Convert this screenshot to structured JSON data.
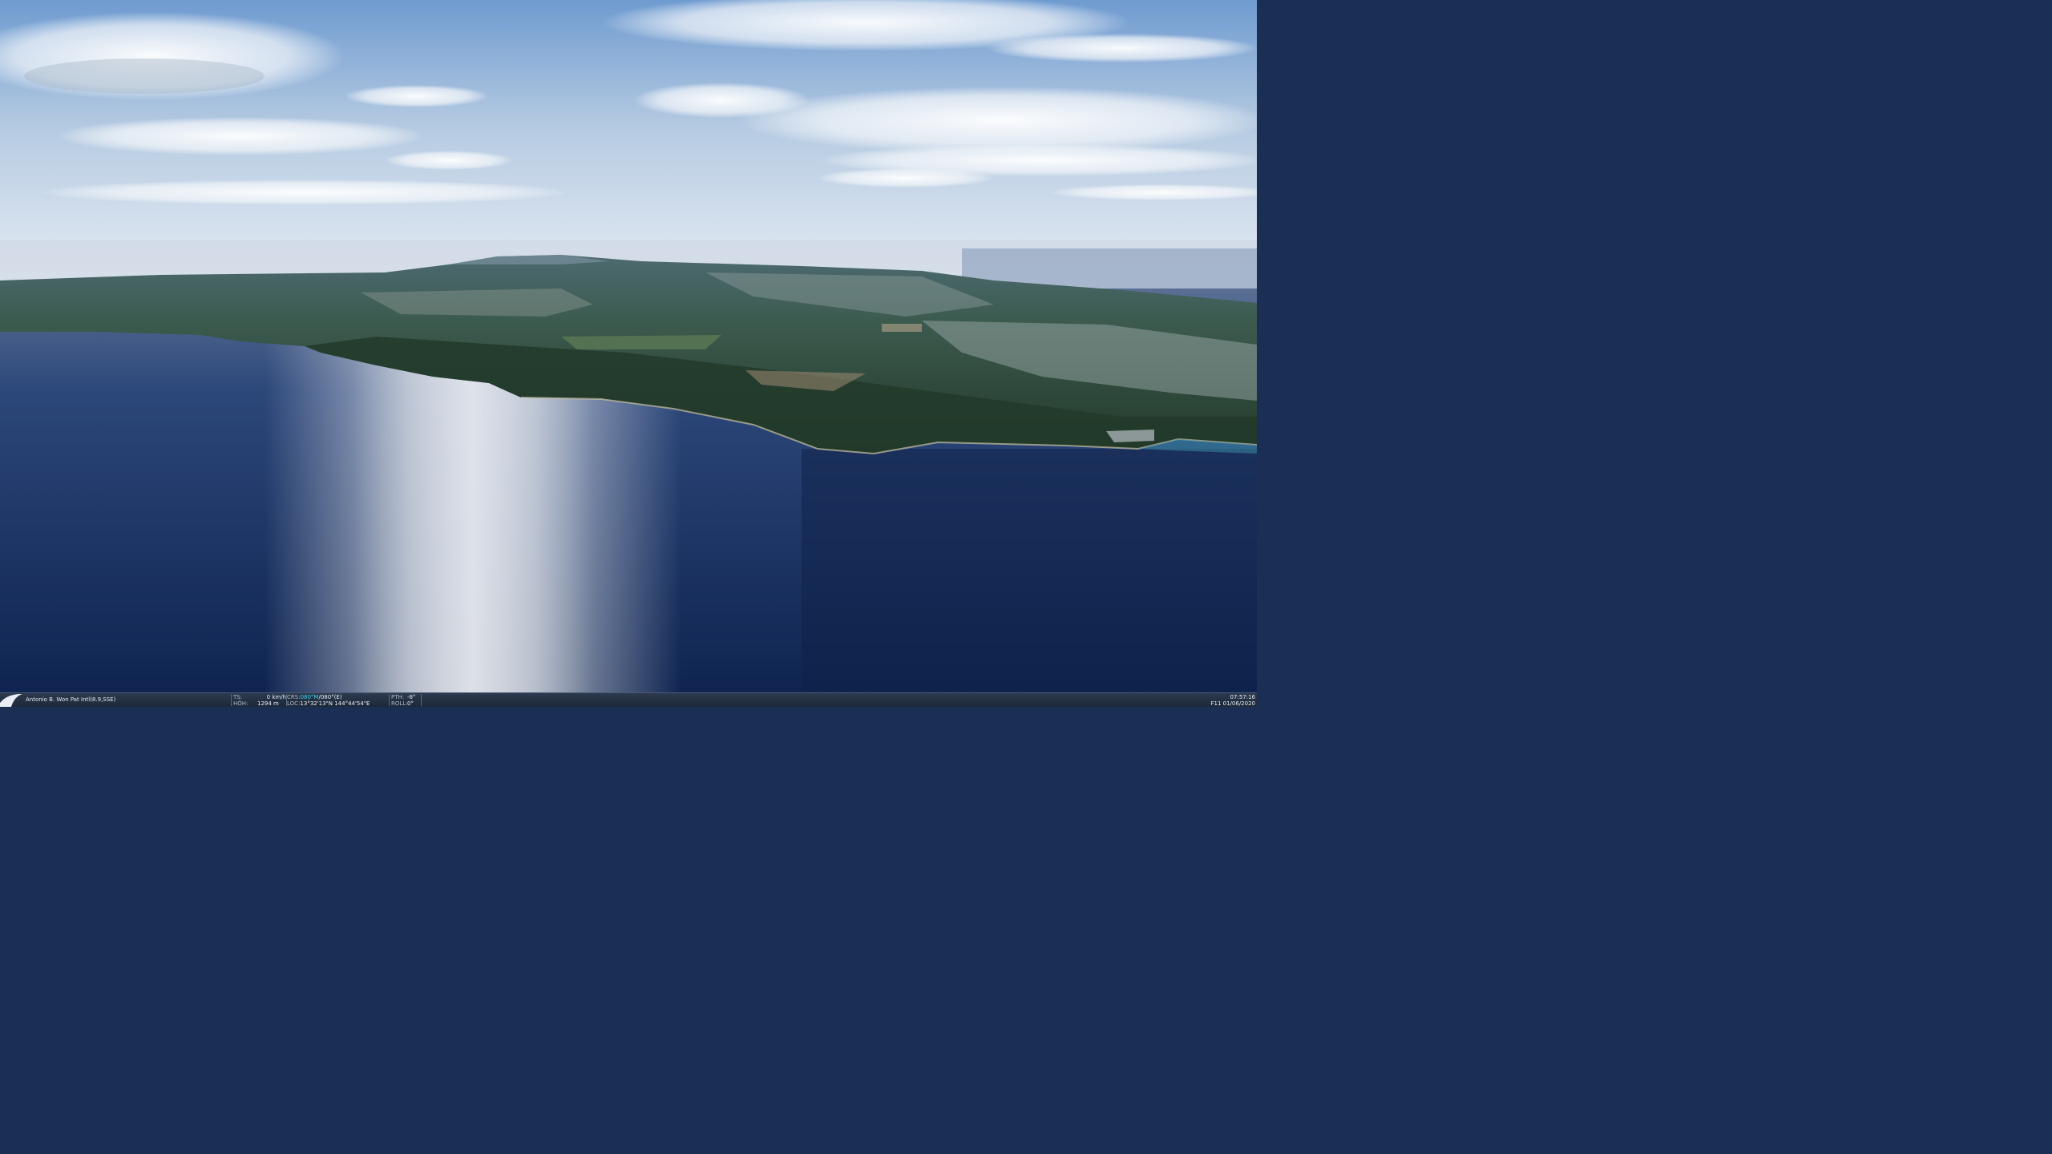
{
  "viewport": {
    "scene": "aerial view",
    "colors": {
      "sky_top": "#6f9bd0",
      "sky_horizon": "#e7edf4",
      "sea_dark": "#112752",
      "sea_glare": "#dfe3ea",
      "land": "#3a5848",
      "forest": "#263f2c"
    }
  },
  "statusbar": {
    "logo_icon": "app-logo-icon",
    "airport": "Antonio B. Won Pat Intl(8.9,SSE)",
    "ts_label": "TS:",
    "ts_value": "0 km/h",
    "hoh_label": "HÖH:",
    "hoh_value": "1294 m",
    "crs_label": "CRS:",
    "crs_magnetic": "080°M",
    "crs_true": "/080°(E)",
    "loc_label": "LOC:",
    "loc_value": "13°32'13\"N 144°44'54\"E",
    "pth_label": "PTH:",
    "pth_value": "-8°",
    "roll_label": "ROLL:",
    "roll_value": "0°",
    "time": "07:57:16",
    "date": "F11 01/06/2020"
  }
}
